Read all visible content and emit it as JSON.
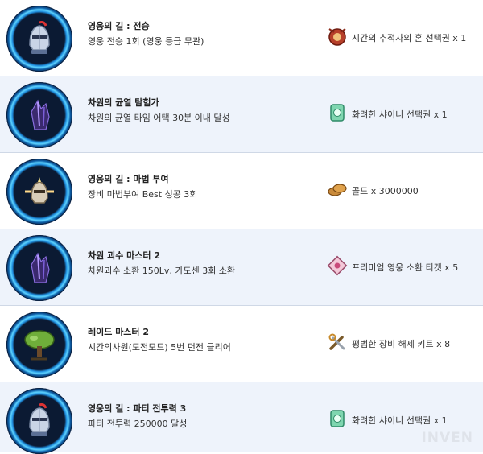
{
  "achievements": [
    {
      "title": "영웅의 길 : 전승",
      "description": "영웅 전승 1회 (영웅 등급 무관)",
      "reward": "시간의 추적자의 혼 선택권 x 1",
      "badge_icon": "knight-helmet-icon",
      "reward_icon": "soul-orb-icon"
    },
    {
      "title": "차원의 균열 탐험가",
      "description": "차원의 균열 타임 어택 30분 이내 달성",
      "reward": "화려한 샤이니 선택권 x 1",
      "badge_icon": "crystal-rift-icon",
      "reward_icon": "green-ticket-icon"
    },
    {
      "title": "영웅의 길 : 마법 부여",
      "description": "장비 마법부여 Best 성공 3회",
      "reward": "골드 x 3000000",
      "badge_icon": "enchant-armor-icon",
      "reward_icon": "gold-coins-icon"
    },
    {
      "title": "차원 괴수 마스터 2",
      "description": "차원괴수 소환 150Lv, 가도센 3회 소환",
      "reward": "프리미엄 영웅 소환 티켓 x 5",
      "badge_icon": "crystal-rift-icon",
      "reward_icon": "premium-ticket-icon"
    },
    {
      "title": "레이드 마스터 2",
      "description": "시간의사원(도전모드) 5번 던전 클리어",
      "reward": "평범한 장비 해제 키트 x 8",
      "badge_icon": "tree-icon",
      "reward_icon": "tools-icon"
    },
    {
      "title": "영웅의 길 : 파티 전투력 3",
      "description": "파티 전투력 250000 달성",
      "reward": "화려한 샤이니 선택권 x 1",
      "badge_icon": "knight-helmet-icon",
      "reward_icon": "green-ticket-icon"
    }
  ],
  "watermark": "INVEN"
}
